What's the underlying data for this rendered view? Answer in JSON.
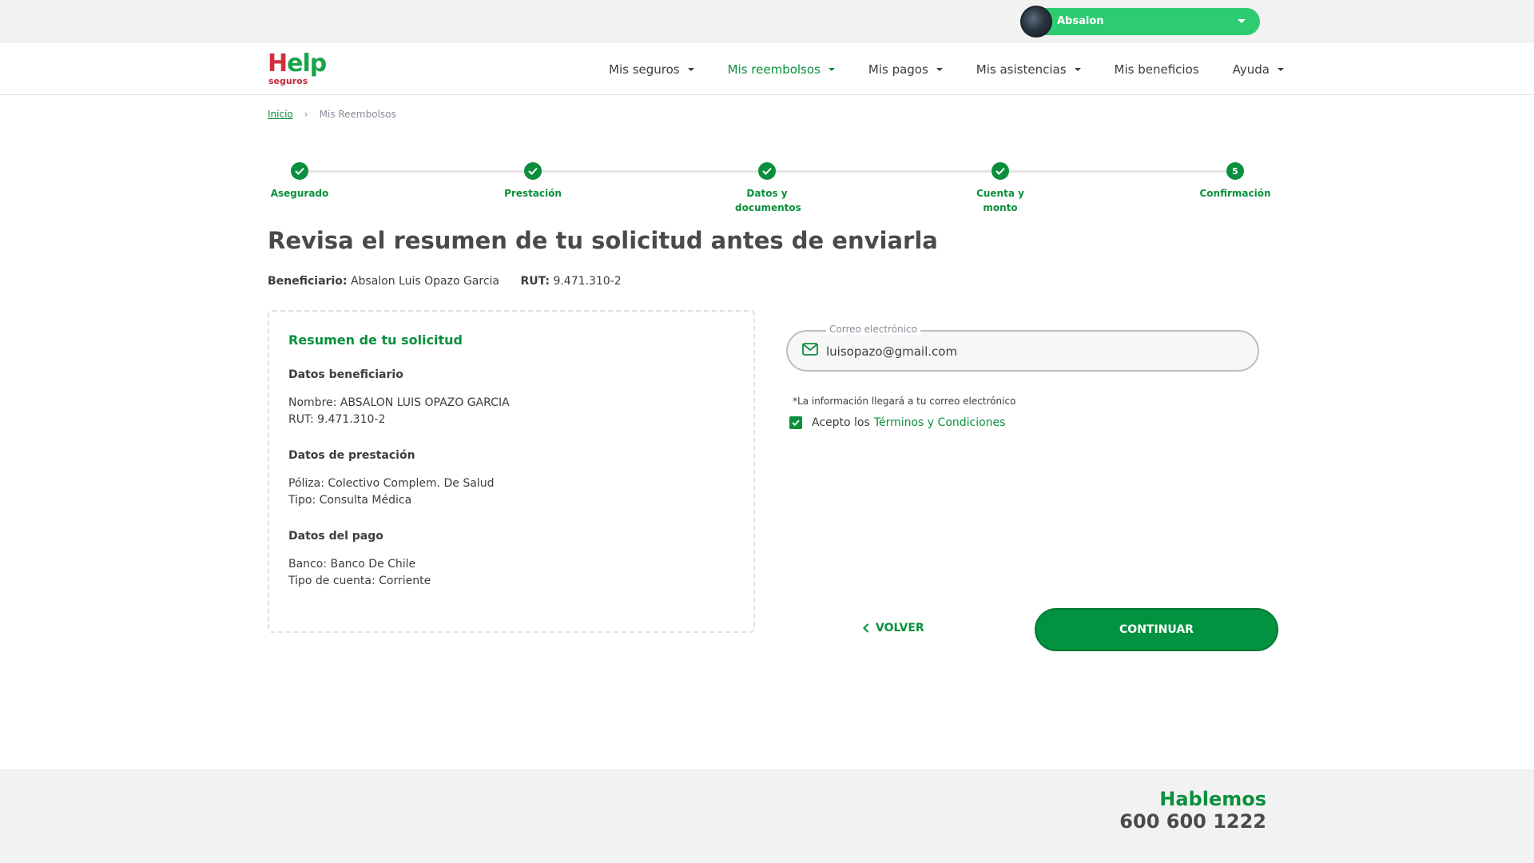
{
  "user": {
    "name": "Absalon"
  },
  "brand": {
    "logo_main": "Help",
    "logo_sub": "seguros",
    "primary_color": "#0a8f3c",
    "accent_color": "#2ecc71"
  },
  "nav": {
    "items": [
      {
        "label": "Mis seguros",
        "has_dropdown": true,
        "active": false
      },
      {
        "label": "Mis reembolsos",
        "has_dropdown": true,
        "active": true
      },
      {
        "label": "Mis pagos",
        "has_dropdown": true,
        "active": false
      },
      {
        "label": "Mis asistencias",
        "has_dropdown": true,
        "active": false
      },
      {
        "label": "Mis beneficios",
        "has_dropdown": false,
        "active": false
      },
      {
        "label": "Ayuda",
        "has_dropdown": true,
        "active": false
      }
    ]
  },
  "breadcrumb": {
    "home": "Inicio",
    "separator": "›",
    "current": "Mis Reembolsos"
  },
  "stepper": {
    "steps": [
      {
        "label": "Asegurado",
        "state": "done",
        "number": "1"
      },
      {
        "label": "Prestación",
        "state": "done",
        "number": "2"
      },
      {
        "label": "Datos y documentos",
        "state": "done",
        "number": "3"
      },
      {
        "label": "Cuenta y monto",
        "state": "done",
        "number": "4"
      },
      {
        "label": "Confirmación",
        "state": "current",
        "number": "5"
      }
    ]
  },
  "page": {
    "title": "Revisa el resumen de tu solicitud antes de enviarla",
    "beneficiary_label": "Beneficiario:",
    "beneficiary_value": "Absalon Luis Opazo Garcia",
    "rut_label": "RUT:",
    "rut_value": "9.471.310-2"
  },
  "summary": {
    "title": "Resumen de tu solicitud",
    "sections": [
      {
        "title": "Datos beneficiario",
        "lines": [
          "Nombre: ABSALON LUIS OPAZO GARCIA",
          "RUT: 9.471.310-2"
        ]
      },
      {
        "title": "Datos de prestación",
        "lines": [
          "Póliza: Colectivo Complem. De Salud",
          "Tipo: Consulta Médica"
        ]
      },
      {
        "title": "Datos del pago",
        "lines": [
          "Banco: Banco De Chile",
          "Tipo de cuenta: Corriente"
        ]
      }
    ]
  },
  "email": {
    "label": "Correo electrónico",
    "value": "luisopazo@gmail.com",
    "icon": "mail-icon",
    "note": "*La información llegará a tu correo electrónico"
  },
  "terms": {
    "checked": true,
    "prefix": "Acepto los",
    "link": "Términos y Condiciones"
  },
  "actions": {
    "back_label": "VOLVER",
    "continue_label": "CONTINUAR"
  },
  "footer": {
    "title": "Hablemos",
    "phone": "600 600 1222"
  }
}
